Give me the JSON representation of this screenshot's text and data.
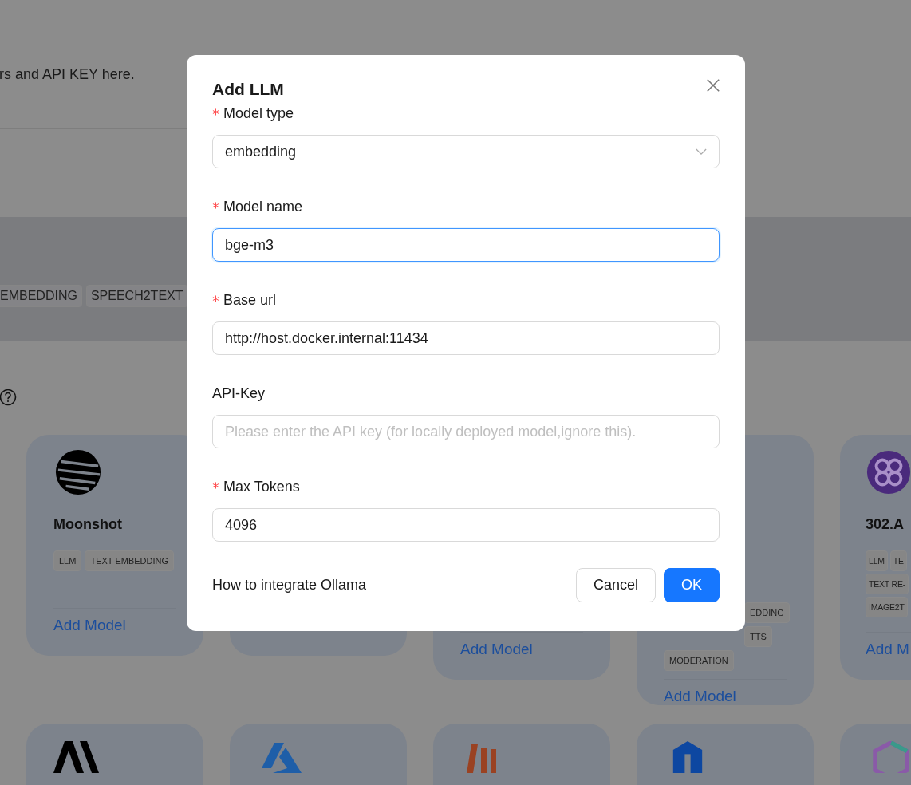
{
  "page": {
    "description": "rs and API KEY here.",
    "tags": [
      {
        "label": "EMBEDDING"
      },
      {
        "label": "SPEECH2TEXT"
      }
    ]
  },
  "cards": [
    {
      "kind": "moonshot",
      "name": "Moonshot",
      "tags": [
        "LLM",
        "TEXT EMBEDDING"
      ],
      "action": "Add Model"
    },
    {
      "kind": "blank"
    },
    {
      "kind": "blank",
      "action": "Add Model"
    },
    {
      "kind": "blank",
      "tags": [
        "EDDING",
        "TTS",
        "MODERATION"
      ],
      "action": "Add Model"
    },
    {
      "kind": "flower",
      "name": "302.A",
      "tags": [
        "LLM",
        "TE",
        "TEXT RE-",
        "IMAGE2T"
      ],
      "action": "Add M"
    }
  ],
  "cards_row_2": [
    {
      "kind": "slash"
    },
    {
      "kind": "triangle"
    },
    {
      "kind": "bars"
    },
    {
      "kind": "hexagon"
    },
    {
      "kind": "cube"
    }
  ],
  "dialog": {
    "title": "Add LLM",
    "fields": [
      {
        "kind": "select",
        "label": "Model type",
        "required": true,
        "focused": false,
        "value": "embedding"
      },
      {
        "kind": "input",
        "label": "Model name",
        "required": true,
        "focused": true,
        "value": "bge-m3"
      },
      {
        "kind": "input",
        "label": "Base url",
        "required": true,
        "focused": false,
        "value": "http://host.docker.internal:11434"
      },
      {
        "kind": "input",
        "label": "API-Key",
        "required": false,
        "focused": false,
        "placeholder": "Please enter the API key (for locally deployed model,ignore this)."
      },
      {
        "kind": "input",
        "label": "Max Tokens",
        "required": true,
        "focused": false,
        "value": "4096"
      }
    ],
    "help_link": "How to integrate Ollama",
    "buttons": [
      {
        "kind": "default",
        "label": "Cancel"
      },
      {
        "kind": "primary",
        "label": "OK"
      }
    ]
  }
}
